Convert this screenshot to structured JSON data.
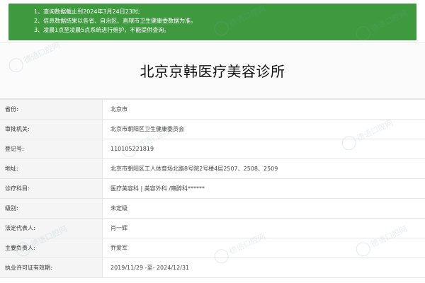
{
  "notice": {
    "lines": [
      "1、查询数据截止到2024年3月24日23时;",
      "2、信息数据结果以各省、自治区、直辖市卫生健康委数据为准。",
      "3、凌晨1点至凌晨5点系统进行维护，不能提供查询。"
    ],
    "background_color": "#3f9a3f"
  },
  "title": "北京京韩医疗美容诊所",
  "info_rows": [
    {
      "label": "省份:",
      "value": "北京市"
    },
    {
      "label": "审批机关:",
      "value": "北京市朝阳区卫生健康委员会"
    },
    {
      "label": "登记号:",
      "value": "110105221819"
    },
    {
      "label": "地址:",
      "value": "北京市朝阳区工人体育场北路8号院2号楼4层2507、2508、2509"
    },
    {
      "label": "诊疗科目:",
      "value": "医疗美容科 | 美容外科 /麻醉科******"
    },
    {
      "label": "级别:",
      "value": "未定级"
    },
    {
      "label": "法定代表人:",
      "value": "肖一辉"
    },
    {
      "label": "主要负责人:",
      "value": "乔爱军"
    },
    {
      "label": "执业许可证有效期:",
      "value": "2019/11/29 -至- 2024/12/31"
    }
  ],
  "watermark": {
    "text": "德语口腔网",
    "icon": "tooth-logo-icon"
  }
}
